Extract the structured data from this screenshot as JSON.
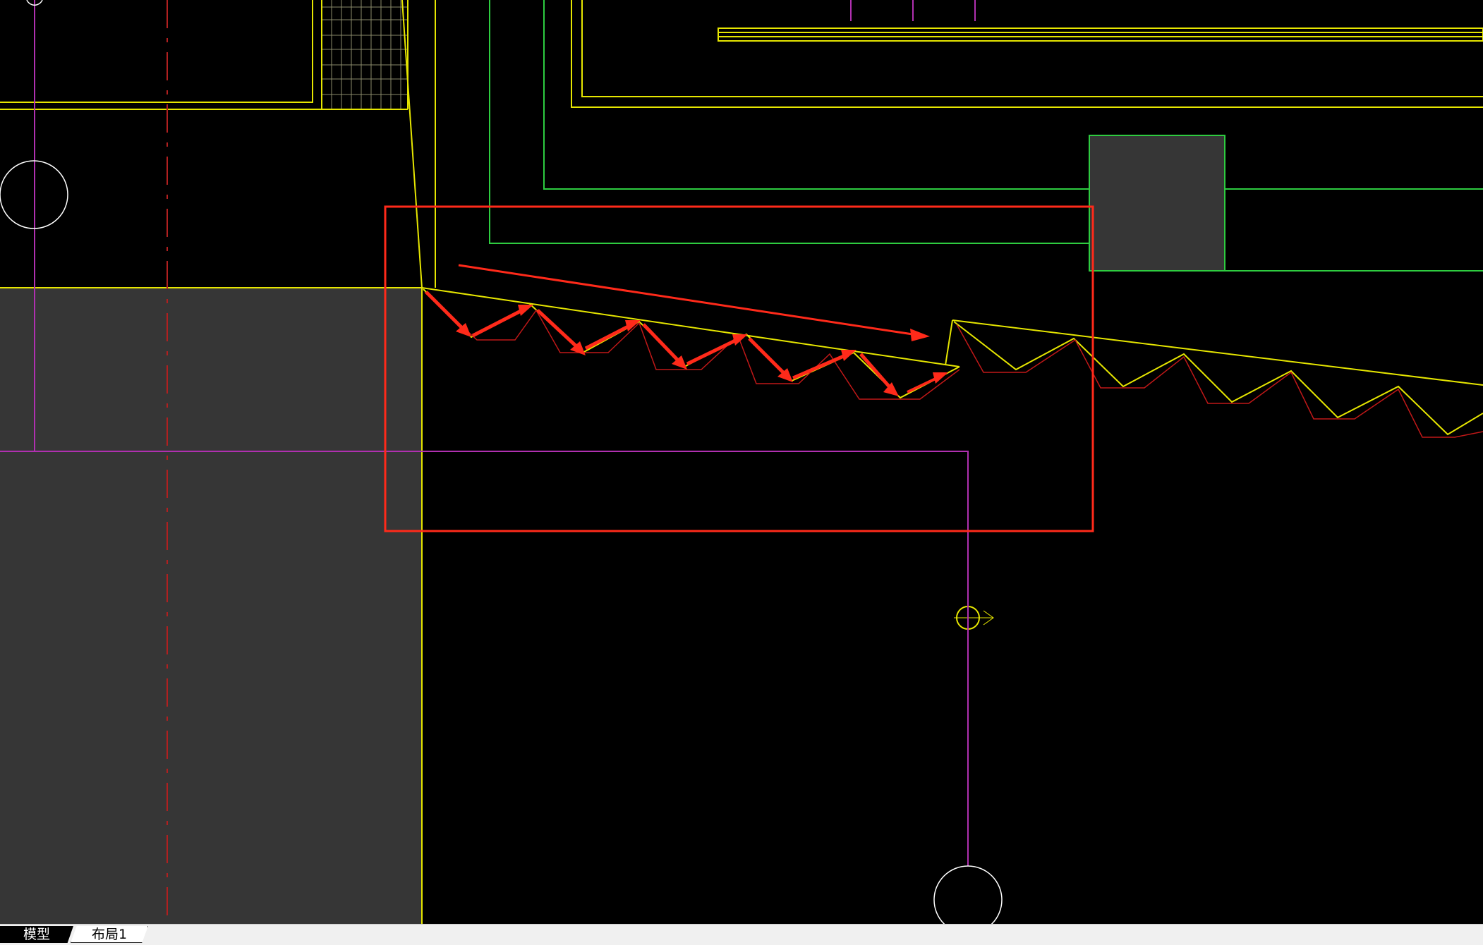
{
  "tabs": {
    "model_label": "模型",
    "layout1_label": "布局1"
  },
  "colors": {
    "background": "#000000",
    "yellow_lines": "#e6e600",
    "green_lines": "#2ecc40",
    "magenta_lines": "#b030b0",
    "red_annotation": "#ff2a1a",
    "red_centerline": "#b02020",
    "gray_fill": "#363636",
    "white_symbols": "#ffffff"
  }
}
